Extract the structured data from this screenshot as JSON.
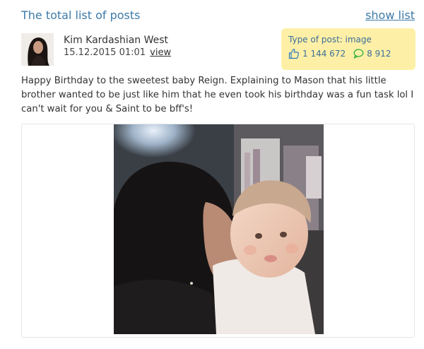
{
  "header": {
    "title": "The total list of posts",
    "show_list_label": "show list"
  },
  "post": {
    "author": "Kim Kardashian West",
    "date": "15.12.2015 01:01",
    "view_label": "view",
    "type_label": "Type of post: image",
    "likes": "1 144 672",
    "comments": "8 912",
    "text": "Happy Birthday to the sweetest baby Reign. Explaining to Mason that his little brother wanted to be just like him that he even took his birthday was a fun task lol I can't wait for you & Saint to be bff's!"
  },
  "colors": {
    "accent": "#3d7aa8",
    "stats_bg": "#fdf0a6",
    "like_icon": "#2a78c2",
    "comment_icon": "#2fae3f"
  },
  "icons": {
    "like": "thumbs-up-icon",
    "comment": "speech-bubble-icon"
  }
}
